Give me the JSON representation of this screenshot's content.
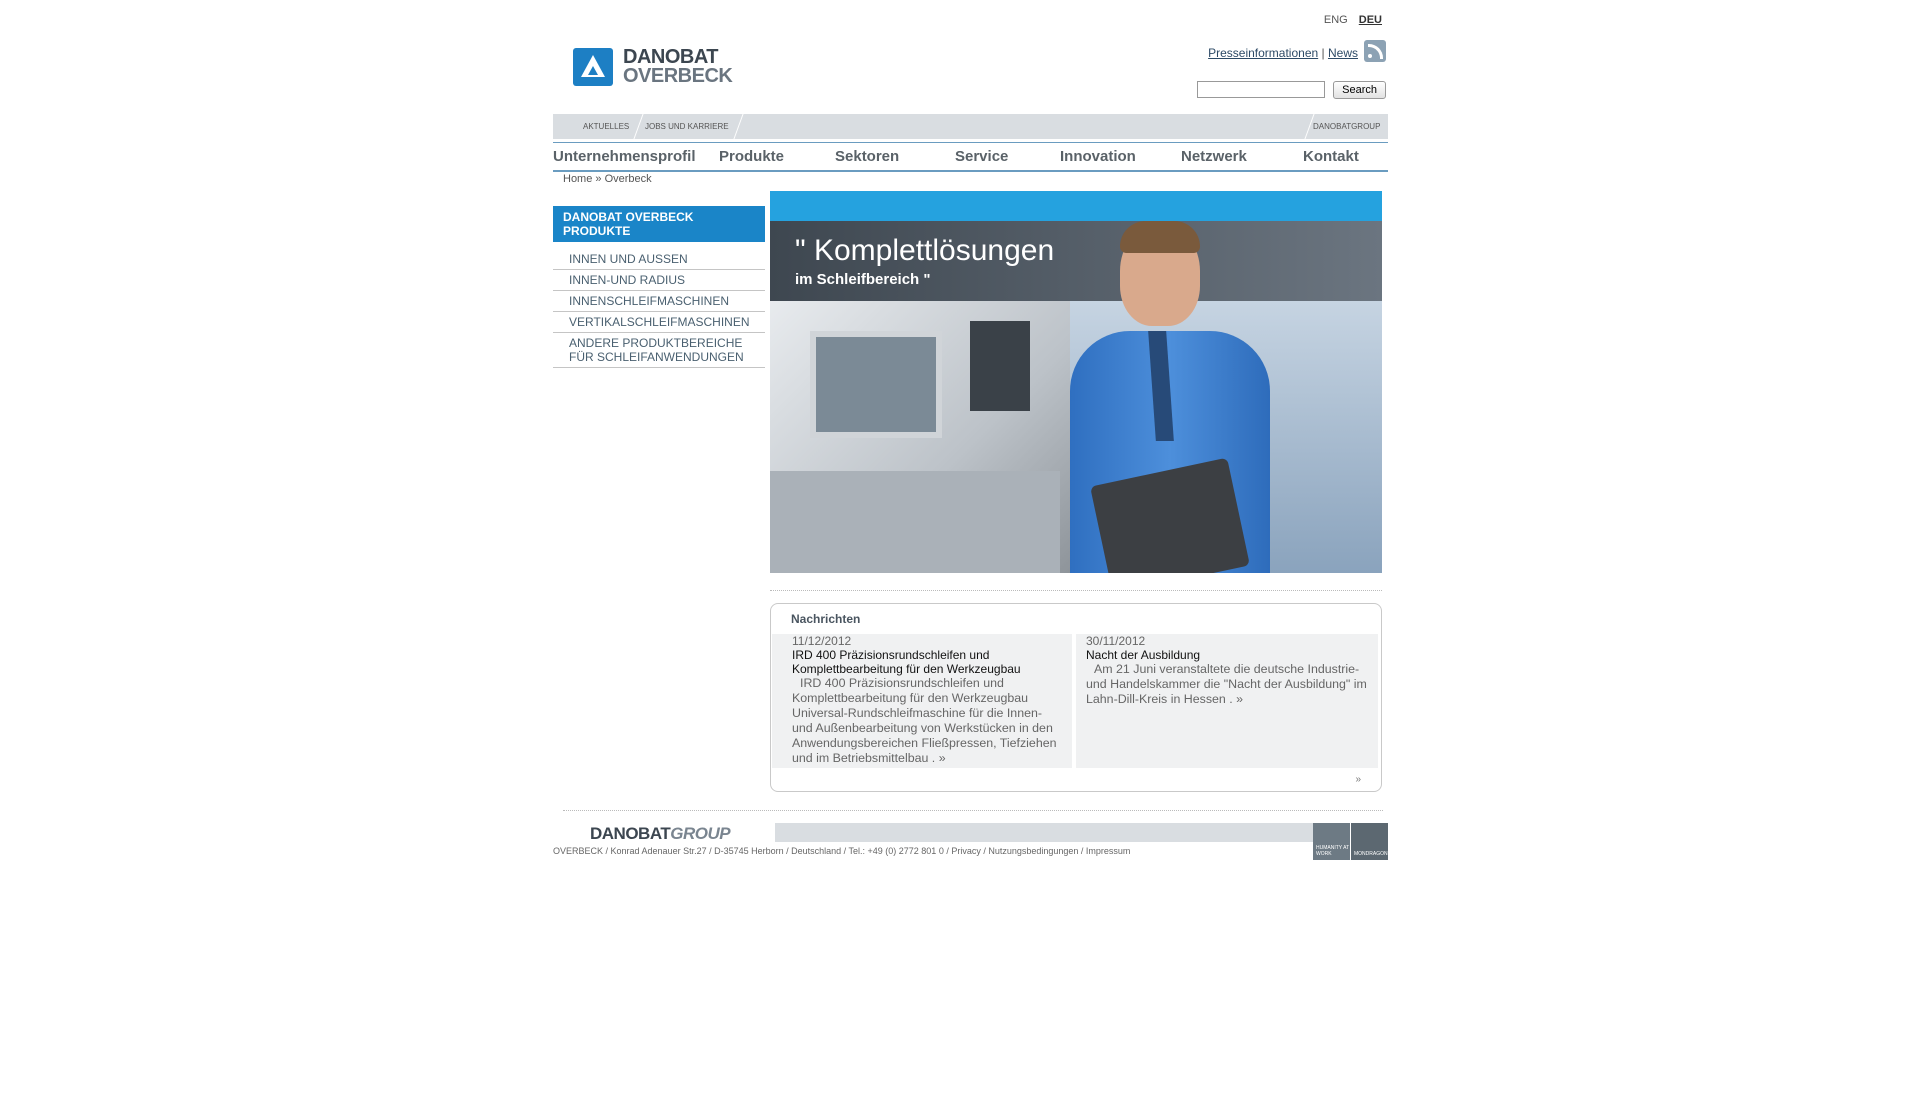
{
  "lang": {
    "eng": "ENG",
    "deu": "DEU"
  },
  "logo": {
    "line1": "DANOBAT",
    "line2": "OVERBECK"
  },
  "toplinks": {
    "press": "Presseinformationen",
    "sep": "|",
    "news": "News"
  },
  "search": {
    "placeholder": "",
    "button": "Search"
  },
  "subbar": {
    "aktuelles": "AKTUELLES",
    "jobs": "JOBS UND KARRIERE",
    "group": "DANOBATGROUP"
  },
  "nav": [
    "Unternehmensprofil",
    "Produkte",
    "Sektoren",
    "Service",
    "Innovation",
    "Netzwerk",
    "Kontakt"
  ],
  "breadcrumb": "Home » Overbeck",
  "sidebar": {
    "title": "DANOBAT OVERBECK PRODUKTE",
    "items": [
      "INNEN UND AUSSEN",
      "INNEN-UND RADIUS",
      "INNENSCHLEIFMASCHINEN",
      "VERTIKALSCHLEIFMASCHINEN",
      "ANDERE PRODUKTBEREICHE FÜR SCHLEIFANWENDUNGEN"
    ]
  },
  "hero": {
    "headline": "\" Komplettlösungen",
    "subline": "im Schleifbereich \""
  },
  "news": {
    "header": "Nachrichten",
    "items": [
      {
        "date": "11/12/2012",
        "title": "IRD 400 Präzisionsrundschleifen und Komplettbearbeitung für den Werkzeugbau",
        "text": "IRD 400 Präzisionsrundschleifen und Komplettbearbeitung für den Werkzeugbau Universal-Rundschleifmaschine für die Innen- und Außenbearbeitung von Werkstücken in den Anwendungsbereichen Fließpressen, Tiefziehen und im Betriebsmittelbau . »"
      },
      {
        "date": "30/11/2012",
        "title": "Nacht der Ausbildung",
        "text": "Am 21 Juni veranstaltete die deutsche Industrie-und Handelskammer die \"Nacht der Ausbildung\" im Lahn-Dill-Kreis in Hessen . »"
      }
    ],
    "more": "»"
  },
  "footer": {
    "logo_main": "DANOBAT",
    "logo_sub": "GROUP",
    "box1": "HUMANITY AT WORK",
    "box2": "MONDRAGON",
    "text": "OVERBECK / Konrad Adenauer Str.27 / D-35745 Herborn / Deutschland / Tel.: +49 (0) 2772 801 0 / Privacy / Nutzungsbedingungen / Impressum"
  }
}
